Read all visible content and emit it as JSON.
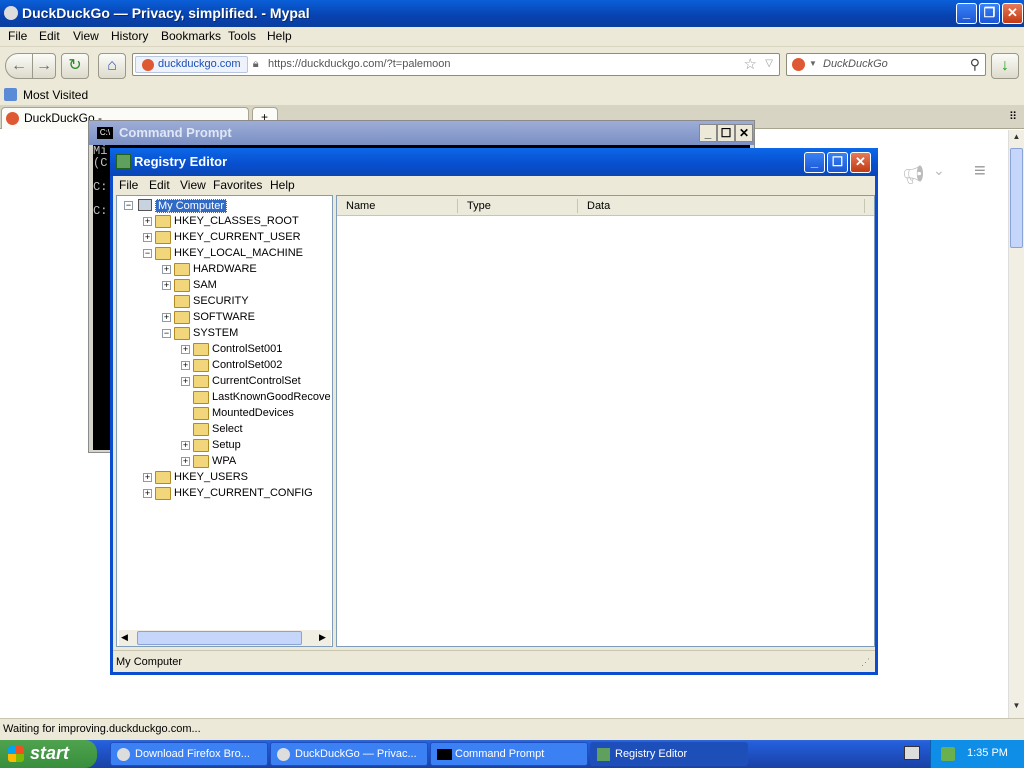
{
  "firefox": {
    "title": "DuckDuckGo — Privacy, simplified. - Mypal",
    "menu": [
      "File",
      "Edit",
      "View",
      "History",
      "Bookmarks",
      "Tools",
      "Help"
    ],
    "identity": "duckduckgo.com",
    "url": "https://duckduckgo.com/?t=palemoon",
    "search_placeholder": "DuckDuckGo",
    "bookmark": "Most Visited",
    "tab_label": "DuckDuckGo - ",
    "status": "Waiting for improving.duckduckgo.com..."
  },
  "cmd": {
    "title": "Command Prompt",
    "lines": [
      "Mi",
      "(C",
      "",
      "C:",
      "",
      "C:"
    ]
  },
  "regedit": {
    "title": "Registry Editor",
    "menu": [
      "File",
      "Edit",
      "View",
      "Favorites",
      "Help"
    ],
    "columns": [
      "Name",
      "Type",
      "Data"
    ],
    "tree": {
      "root": "My Computer",
      "hkcr": "HKEY_CLASSES_ROOT",
      "hkcu": "HKEY_CURRENT_USER",
      "hklm": "HKEY_LOCAL_MACHINE",
      "hardware": "HARDWARE",
      "sam": "SAM",
      "security": "SECURITY",
      "software": "SOFTWARE",
      "system": "SYSTEM",
      "cs001": "ControlSet001",
      "cs002": "ControlSet002",
      "ccs": "CurrentControlSet",
      "lkgr": "LastKnownGoodRecove",
      "mounted": "MountedDevices",
      "select": "Select",
      "setup": "Setup",
      "wpa": "WPA",
      "hku": "HKEY_USERS",
      "hkcc": "HKEY_CURRENT_CONFIG"
    },
    "status": "My Computer"
  },
  "taskbar": {
    "start": "start",
    "tasks": [
      "Download Firefox Bro...",
      "DuckDuckGo — Privac...",
      "Command Prompt",
      "Registry Editor"
    ],
    "clock": "1:35 PM"
  }
}
